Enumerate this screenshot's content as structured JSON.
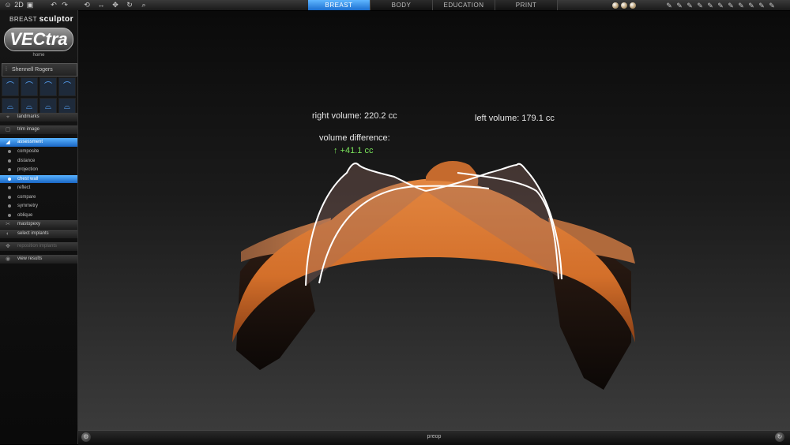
{
  "toolbar": {
    "left_icons": [
      "person-icon",
      "2d-icon",
      "camera-icon",
      "undo-icon",
      "redo-icon",
      "rotate-icon",
      "move-icon",
      "pan-icon",
      "refresh-icon",
      "zoom-icon"
    ],
    "tabs": [
      {
        "label": "BREAST",
        "active": true
      },
      {
        "label": "BODY",
        "active": false
      },
      {
        "label": "EDUCATION",
        "active": false
      },
      {
        "label": "PRINT",
        "active": false
      }
    ],
    "right_icons": [
      "light-sphere-icon",
      "light-sphere-icon",
      "light-sphere-icon",
      "pen-tool-icon",
      "pen-tool-icon",
      "pen-tool-icon",
      "pen-tool-icon",
      "pen-tool-icon",
      "pen-tool-icon",
      "pen-tool-icon",
      "pen-tool-icon"
    ]
  },
  "sidebar": {
    "brand_small": "BREAST",
    "brand_bold": "sculptor",
    "logo_text": "VECtra",
    "home_label": "home",
    "patient_name": "Shennell Rogers",
    "menu": [
      {
        "label": "landmarks",
        "active": false,
        "disabled": false
      },
      {
        "label": "trim image",
        "active": false,
        "disabled": false
      },
      {
        "label": "assessment",
        "active": true,
        "disabled": false
      }
    ],
    "assessment_items": [
      {
        "label": "composite",
        "active": false
      },
      {
        "label": "distance",
        "active": false
      },
      {
        "label": "projection",
        "active": false
      },
      {
        "label": "chest wall",
        "active": true
      },
      {
        "label": "reflect",
        "active": false
      },
      {
        "label": "compare",
        "active": false
      },
      {
        "label": "symmetry",
        "active": false
      },
      {
        "label": "oblique",
        "active": false
      }
    ],
    "menu_bottom": [
      {
        "label": "mastopexy",
        "disabled": false
      },
      {
        "label": "select implants",
        "disabled": false
      },
      {
        "label": "reposition implants",
        "disabled": true
      },
      {
        "label": "view results",
        "disabled": false
      }
    ]
  },
  "viewport": {
    "right_volume": "right volume: 220.2 cc",
    "left_volume": "left volume: 179.1 cc",
    "volume_difference_label": "volume difference:",
    "volume_difference_value": "↑ +41.1 cc",
    "colors": {
      "skin": "#d97630",
      "skin_dark": "#a34e1c",
      "outline": "#ffffff",
      "difference": "#79e25a"
    }
  },
  "status": {
    "text": "preop"
  }
}
